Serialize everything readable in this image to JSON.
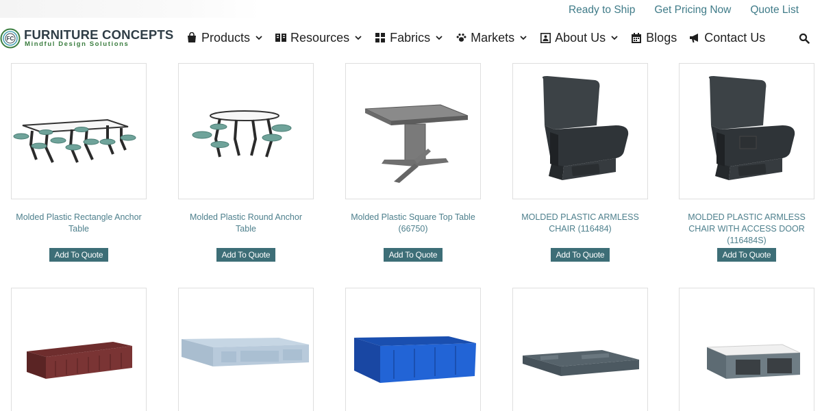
{
  "top_links": [
    "Ready to Ship",
    "Get Pricing Now",
    "Quote List"
  ],
  "brand": {
    "name": "FURNITURE CONCEPTS",
    "tagline": "Mindful Design Solutions",
    "logo_letters": "FC",
    "icon": "fc-logo-icon"
  },
  "nav": [
    {
      "label": "Products",
      "icon": "shopping-bag-icon",
      "dropdown": true
    },
    {
      "label": "Resources",
      "icon": "book-icon",
      "dropdown": true
    },
    {
      "label": "Fabrics",
      "icon": "grid-icon",
      "dropdown": true
    },
    {
      "label": "Markets",
      "icon": "paw-icon",
      "dropdown": true
    },
    {
      "label": "About Us",
      "icon": "address-card-icon",
      "dropdown": true
    },
    {
      "label": "Blogs",
      "icon": "calendar-icon",
      "dropdown": false
    },
    {
      "label": "Contact Us",
      "icon": "megaphone-icon",
      "dropdown": false
    }
  ],
  "search_icon": "search-icon",
  "add_to_quote_label": "Add To Quote",
  "products": [
    {
      "title": "Molded Plastic Rectangle Anchor Table",
      "image": "rectangle-picnic-table"
    },
    {
      "title": "Molded Plastic Round Anchor Table",
      "image": "round-picnic-table"
    },
    {
      "title": "Molded Plastic Square Top Table (66750)",
      "image": "square-top-table"
    },
    {
      "title": "MOLDED PLASTIC ARMLESS CHAIR (116484)",
      "image": "armless-chair"
    },
    {
      "title": "MOLDED PLASTIC ARMLESS CHAIR WITH ACCESS DOOR (116484S)",
      "image": "armless-chair-access-door"
    },
    {
      "title": "",
      "image": "burgundy-bed-frame"
    },
    {
      "title": "",
      "image": "light-blue-bed-frame"
    },
    {
      "title": "",
      "image": "blue-bed-frame"
    },
    {
      "title": "",
      "image": "gray-platform-bed"
    },
    {
      "title": "",
      "image": "gray-bed-with-mattress"
    }
  ],
  "colors": {
    "accent": "#3f7b88",
    "button": "#3d6e77",
    "brand_text": "#2f3d46",
    "brand_green": "#3a7d3f"
  }
}
